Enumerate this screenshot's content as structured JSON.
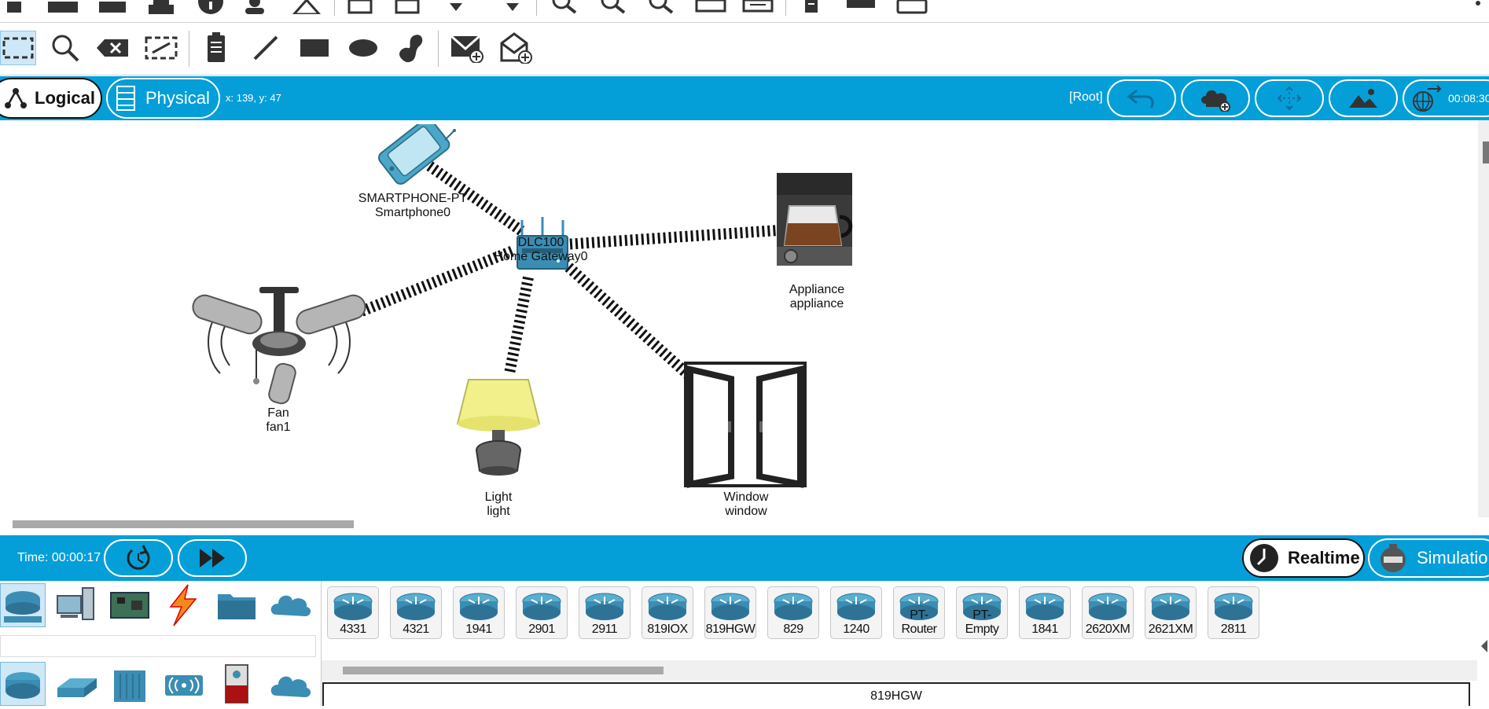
{
  "top_bar": {
    "logical_label": "Logical",
    "physical_label": "Physical",
    "cursor_coords": "x: 139, y: 47",
    "root_label": "[Root]",
    "clock": "00:08:30"
  },
  "devices": [
    {
      "id": "smartphone",
      "line1": "SMARTPHONE-PT",
      "line2": "Smartphone0"
    },
    {
      "id": "gateway",
      "line1": "DLC100",
      "line2": "Home Gateway0"
    },
    {
      "id": "appliance",
      "line1": "Appliance",
      "line2": "appliance"
    },
    {
      "id": "fan",
      "line1": "Fan",
      "line2": "fan1"
    },
    {
      "id": "light",
      "line1": "Light",
      "line2": "light"
    },
    {
      "id": "window",
      "line1": "Window",
      "line2": "window"
    }
  ],
  "bottom_bar": {
    "time_label": "Time: 00:00:17",
    "realtime_label": "Realtime",
    "simulation_label": "Simulation"
  },
  "models": [
    "4331",
    "4321",
    "1941",
    "2901",
    "2911",
    "819IOX",
    "819HGW",
    "829",
    "1240",
    "PT-Router",
    "PT-Empty",
    "1841",
    "2620XM",
    "2621XM",
    "2811"
  ],
  "selected_model": "819HGW",
  "colors": {
    "accent": "#049fd9",
    "router_blue": "#3b8db3"
  }
}
